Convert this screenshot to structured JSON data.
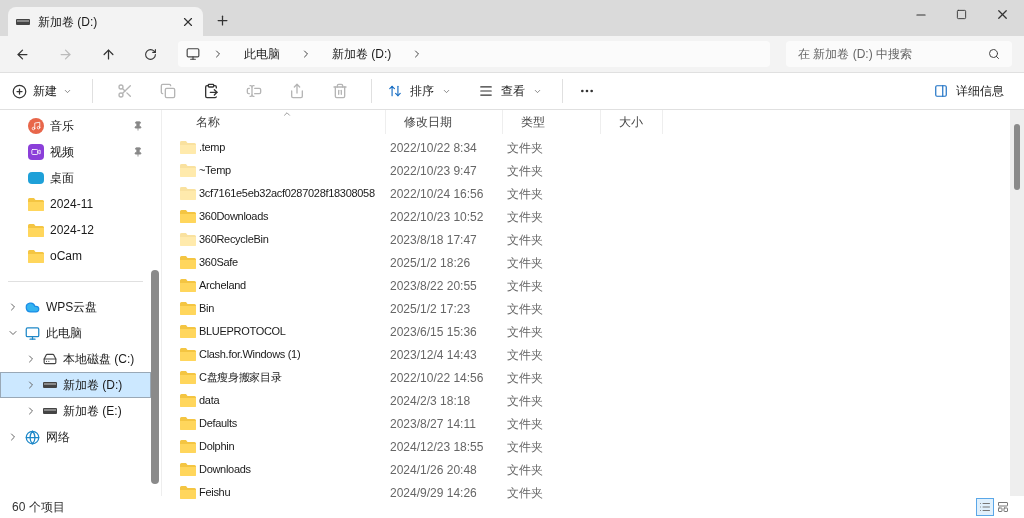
{
  "tabs": [
    {
      "title": "新加卷 (D:)",
      "selected": true
    }
  ],
  "breadcrumb": [
    "此电脑",
    "新加卷 (D:)"
  ],
  "search": {
    "placeholder": "在 新加卷 (D:) 中搜索"
  },
  "toolbar": {
    "new_label": "新建",
    "actions": [
      {
        "kind": "cut",
        "disabled": true
      },
      {
        "kind": "copy",
        "disabled": true
      },
      {
        "kind": "paste",
        "disabled": false
      },
      {
        "kind": "rename",
        "disabled": true
      },
      {
        "kind": "share",
        "disabled": true
      },
      {
        "kind": "delete",
        "disabled": true
      }
    ],
    "sort_label": "排序",
    "view_label": "查看",
    "details_label": "详细信息"
  },
  "quick_access": [
    {
      "label": "音乐",
      "kind": "music",
      "pinned": true
    },
    {
      "label": "视频",
      "kind": "video",
      "pinned": true
    },
    {
      "label": "桌面",
      "kind": "desktop",
      "pinned": false
    },
    {
      "label": "2024-11",
      "kind": "folder",
      "pinned": false
    },
    {
      "label": "2024-12",
      "kind": "folder",
      "pinned": false
    },
    {
      "label": "oCam",
      "kind": "folder",
      "pinned": false
    }
  ],
  "tree": [
    {
      "label": "WPS云盘",
      "kind": "cloud",
      "expanded": false,
      "selected": false
    },
    {
      "label": "此电脑",
      "kind": "pc",
      "expanded": true,
      "selected": false,
      "children": [
        {
          "label": "本地磁盘 (C:)",
          "kind": "system-drive",
          "expanded": false,
          "selected": false
        },
        {
          "label": "新加卷 (D:)",
          "kind": "drive",
          "expanded": false,
          "selected": true
        },
        {
          "label": "新加卷 (E:)",
          "kind": "drive",
          "expanded": false,
          "selected": false
        }
      ]
    },
    {
      "label": "网络",
      "kind": "network",
      "expanded": false,
      "selected": false
    }
  ],
  "columns": [
    "名称",
    "修改日期",
    "类型",
    "大小"
  ],
  "rows": [
    {
      "name": ".temp",
      "date": "2022/10/22 8:34",
      "type": "文件夹",
      "hidden": true
    },
    {
      "name": "~Temp",
      "date": "2022/10/23 9:47",
      "type": "文件夹",
      "hidden": true
    },
    {
      "name": "3cf7161e5eb32acf0287028f18308058",
      "date": "2022/10/24 16:56",
      "type": "文件夹",
      "hidden": true
    },
    {
      "name": "360Downloads",
      "date": "2022/10/23 10:52",
      "type": "文件夹",
      "hidden": false
    },
    {
      "name": "360RecycleBin",
      "date": "2023/8/18 17:47",
      "type": "文件夹",
      "hidden": true
    },
    {
      "name": "360Safe",
      "date": "2025/1/2 18:26",
      "type": "文件夹",
      "hidden": false
    },
    {
      "name": "Archeland",
      "date": "2023/8/22 20:55",
      "type": "文件夹",
      "hidden": false
    },
    {
      "name": "Bin",
      "date": "2025/1/2 17:23",
      "type": "文件夹",
      "hidden": false
    },
    {
      "name": "BLUEPROTOCOL",
      "date": "2023/6/15 15:36",
      "type": "文件夹",
      "hidden": false
    },
    {
      "name": "Clash.for.Windows (1)",
      "date": "2023/12/4 14:43",
      "type": "文件夹",
      "hidden": false
    },
    {
      "name": "C盘瘦身搬家目录",
      "date": "2022/10/22 14:56",
      "type": "文件夹",
      "hidden": false
    },
    {
      "name": "data",
      "date": "2024/2/3 18:18",
      "type": "文件夹",
      "hidden": false
    },
    {
      "name": "Defaults",
      "date": "2023/8/27 14:11",
      "type": "文件夹",
      "hidden": false
    },
    {
      "name": "Dolphin",
      "date": "2024/12/23 18:55",
      "type": "文件夹",
      "hidden": false
    },
    {
      "name": "Downloads",
      "date": "2024/1/26 20:48",
      "type": "文件夹",
      "hidden": false
    },
    {
      "name": "Feishu",
      "date": "2024/9/29 14:26",
      "type": "文件夹",
      "hidden": false
    }
  ],
  "status": {
    "count": "60 个项目"
  },
  "view_modes": [
    {
      "kind": "details",
      "selected": true
    },
    {
      "kind": "tiles",
      "selected": false
    }
  ]
}
